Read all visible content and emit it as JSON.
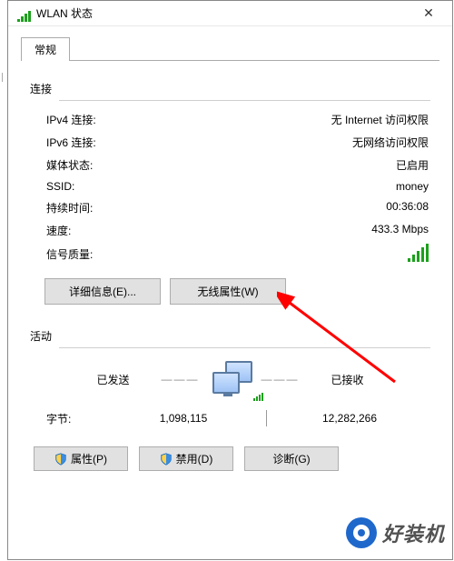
{
  "window": {
    "title": "WLAN 状态",
    "close": "✕"
  },
  "tab": {
    "label": "常规"
  },
  "connection": {
    "section": "连接",
    "rows": {
      "ipv4_label": "IPv4 连接:",
      "ipv4_value": "无 Internet 访问权限",
      "ipv6_label": "IPv6 连接:",
      "ipv6_value": "无网络访问权限",
      "media_label": "媒体状态:",
      "media_value": "已启用",
      "ssid_label": "SSID:",
      "ssid_value": "money",
      "duration_label": "持续时间:",
      "duration_value": "00:36:08",
      "speed_label": "速度:",
      "speed_value": "433.3 Mbps",
      "signal_label": "信号质量:"
    },
    "buttons": {
      "details": "详细信息(E)...",
      "wireless_props": "无线属性(W)"
    }
  },
  "activity": {
    "section": "活动",
    "sent": "已发送",
    "received": "已接收",
    "bytes_label": "字节:",
    "bytes_sent": "1,098,115",
    "bytes_received": "12,282,266"
  },
  "bottom": {
    "properties": "属性(P)",
    "disable": "禁用(D)",
    "diagnose": "诊断(G)"
  },
  "watermark": "好装机"
}
